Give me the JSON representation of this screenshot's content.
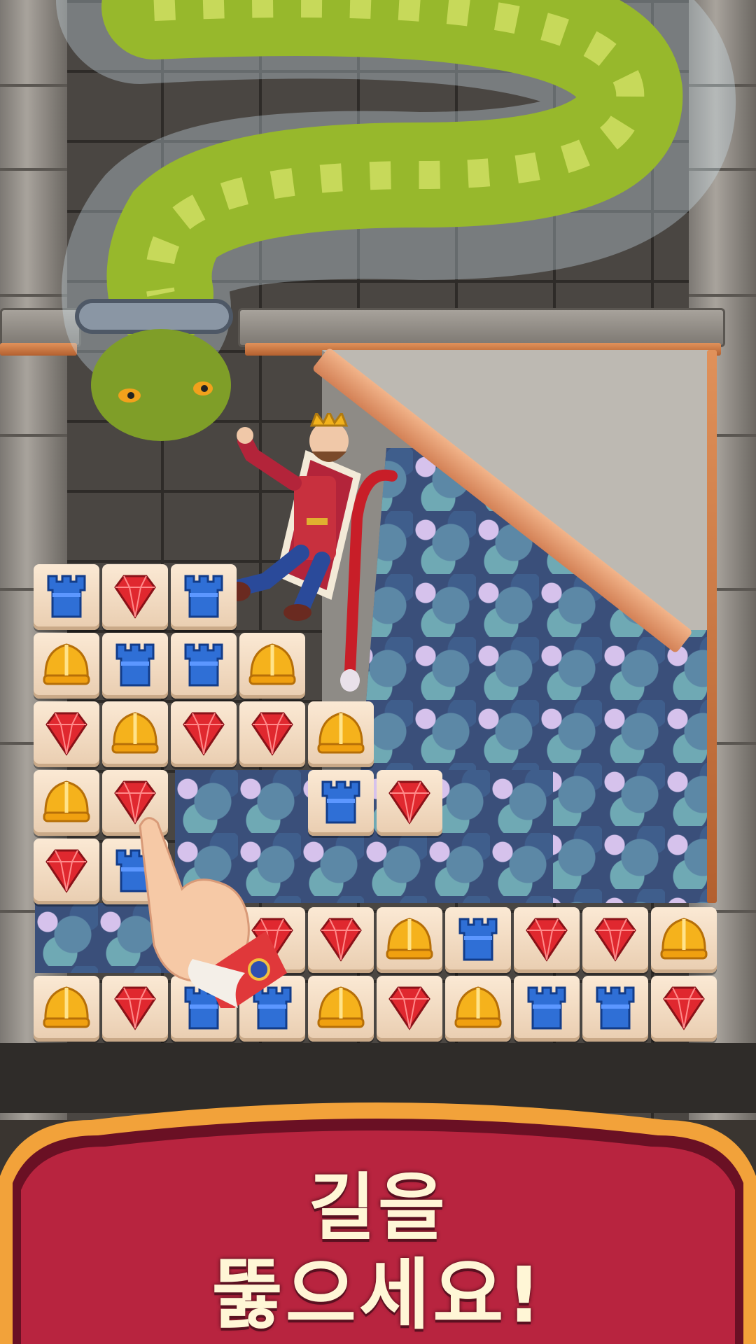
{
  "banner": {
    "line1": "길을",
    "line2": "뚫으세요!"
  },
  "colors": {
    "banner_fill": "#b8243f",
    "banner_border": "#f2a23a",
    "tile": "#f5dfc5",
    "gem_red": "#e0282f",
    "helmet_yellow": "#f5b21c",
    "tower_blue": "#2f6fd6",
    "snake_green": "#9bbd2d"
  },
  "board": {
    "rows": [
      [
        "tower-icon",
        "gem-icon",
        "tower-icon",
        null,
        null,
        null,
        null,
        null,
        null,
        null
      ],
      [
        "helmet-icon",
        "tower-icon",
        "tower-icon",
        "helmet-icon",
        null,
        null,
        null,
        null,
        null,
        null
      ],
      [
        "gem-icon",
        "helmet-icon",
        "gem-icon",
        "gem-icon",
        "helmet-icon",
        null,
        null,
        null,
        null,
        null
      ],
      [
        "helmet-icon",
        "gem-icon",
        null,
        null,
        "tower-icon",
        "gem-icon",
        null,
        null,
        null,
        null
      ],
      [
        "gem-icon",
        "tower-icon",
        null,
        null,
        null,
        null,
        null,
        null,
        null,
        null
      ],
      [
        null,
        null,
        null,
        "gem-icon",
        "gem-icon",
        "helmet-icon",
        "tower-icon",
        "gem-icon",
        "gem-icon",
        "helmet-icon"
      ],
      [
        "helmet-icon",
        "gem-icon",
        "tower-icon",
        "tower-icon",
        "helmet-icon",
        "gem-icon",
        "helmet-icon",
        "tower-icon",
        "tower-icon",
        "gem-icon"
      ]
    ]
  },
  "characters": {
    "king": "king-character",
    "snake": "snake-creature",
    "pointer": "pointing-hand-icon"
  }
}
